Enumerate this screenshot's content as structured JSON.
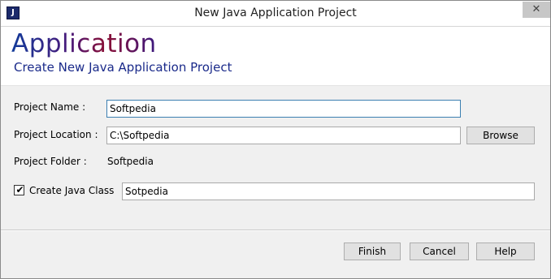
{
  "window": {
    "title": "New Java Application Project",
    "icon_letter": "J",
    "close_glyph": "✕"
  },
  "header": {
    "title": "Application",
    "subtitle": "Create New Java Application Project"
  },
  "form": {
    "project_name": {
      "label": "Project Name :",
      "value": "Softpedia"
    },
    "project_location": {
      "label": "Project Location :",
      "value": "C:\\Softpedia",
      "browse_label": "Browse"
    },
    "project_folder": {
      "label": "Project Folder :",
      "value": "Softpedia"
    },
    "create_java_class": {
      "label": "Create Java Class",
      "checked": true,
      "check_glyph": "✔",
      "value": "Sotpedia"
    }
  },
  "footer": {
    "finish_label": "Finish",
    "cancel_label": "Cancel",
    "help_label": "Help"
  }
}
